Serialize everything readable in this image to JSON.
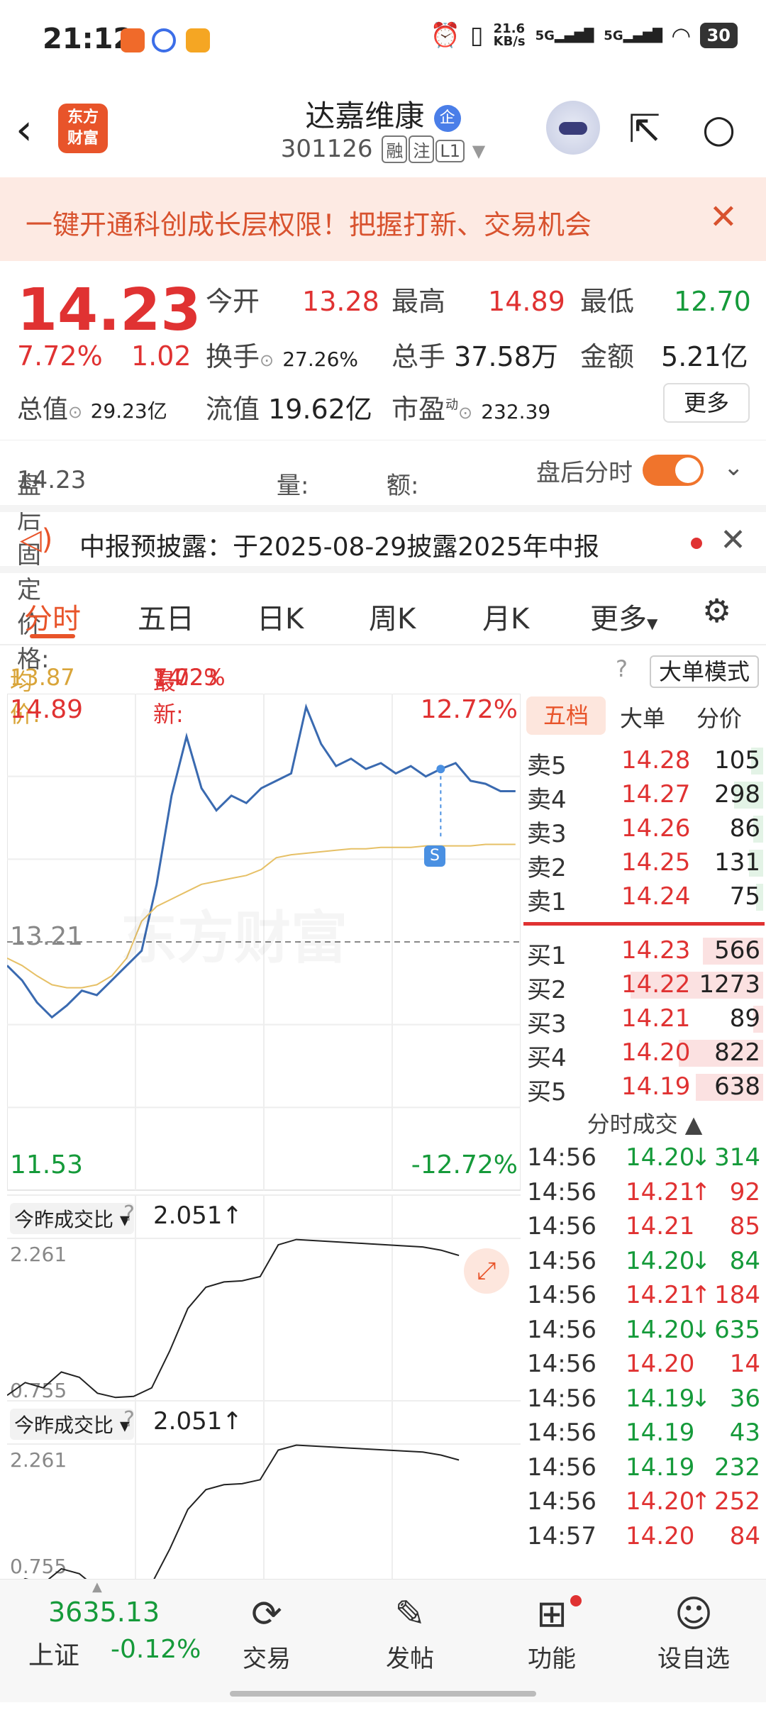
{
  "status_bar": {
    "time": "21:12",
    "net_speed": "21.6\nKB/s",
    "sig1": "5G",
    "sig2": "5G",
    "battery": "30"
  },
  "header": {
    "logo_text": "东方\n财富",
    "stock_name": "达嘉维康",
    "badge": "企",
    "code": "301126",
    "tags": [
      "融",
      "注",
      "L1"
    ]
  },
  "banner": {
    "text": "一键开通科创成长层权限！把握打新、交易机会"
  },
  "quote": {
    "price": "14.23",
    "change_pct": "7.72%",
    "change": "1.02",
    "open_label": "今开",
    "open": "13.28",
    "high_label": "最高",
    "high": "14.89",
    "low_label": "最低",
    "low": "12.70",
    "turnover_label": "换手",
    "turnover": "27.26%",
    "volume_label": "总手",
    "volume": "37.58万",
    "amount_label": "金额",
    "amount": "5.21亿",
    "total_cap_label": "总值",
    "total_cap": "29.23亿",
    "float_cap_label": "流值",
    "float_cap": "19.62亿",
    "pe_label": "市盈",
    "pe_sup": "动",
    "pe": "232.39",
    "more_label": "更多"
  },
  "after_hours": {
    "price_label": "盘后固定价格:",
    "price": "14.23",
    "vol_label": "量:",
    "vol": "--",
    "amt_label": "额:",
    "amt": "--",
    "toggle_label": "盘后分时"
  },
  "notice": {
    "text": "中报预披露：于2025-08-29披露2025年中报"
  },
  "tabs": [
    "分时",
    "五日",
    "日K",
    "周K",
    "月K",
    "更多"
  ],
  "avg_row": {
    "avg_label": "均价:",
    "avg": "13.87",
    "latest_label": "最新:",
    "latest": "14.23",
    "chg": "1.02",
    "pct": "7.72%",
    "mode_btn": "大单模式"
  },
  "chart": {
    "top_price": "14.89",
    "top_pct": "12.72%",
    "mid_price": "13.21",
    "bottom_price": "11.53",
    "bottom_pct": "-12.72%",
    "watermark": "东方财富",
    "marker": "S",
    "sub1_label": "今昨成交比",
    "sub1_value": "2.051",
    "sub1_max": "2.261",
    "sub1_min": "0.755",
    "sub2_label": "今昨成交比",
    "sub2_value": "2.051",
    "sub2_max": "2.261",
    "sub2_min": "0.755"
  },
  "chart_data": {
    "type": "line",
    "series": [
      {
        "name": "最新",
        "color": "#3a6ab0",
        "values": [
          13.05,
          12.95,
          12.8,
          12.7,
          12.78,
          12.88,
          12.85,
          12.95,
          13.05,
          13.15,
          13.6,
          14.2,
          14.6,
          14.25,
          14.1,
          14.2,
          14.15,
          14.25,
          14.3,
          14.35,
          14.8,
          14.55,
          14.4,
          14.45,
          14.38,
          14.42,
          14.35,
          14.4,
          14.33,
          14.38,
          14.42,
          14.3,
          14.28,
          14.23,
          14.23
        ]
      },
      {
        "name": "均价",
        "color": "#e6c066",
        "values": [
          13.1,
          13.05,
          12.98,
          12.92,
          12.9,
          12.9,
          12.92,
          12.98,
          13.1,
          13.35,
          13.45,
          13.5,
          13.55,
          13.6,
          13.62,
          13.64,
          13.66,
          13.7,
          13.78,
          13.8,
          13.81,
          13.82,
          13.83,
          13.84,
          13.84,
          13.85,
          13.85,
          13.85,
          13.86,
          13.86,
          13.86,
          13.86,
          13.87,
          13.87,
          13.87
        ]
      }
    ],
    "ylim": [
      11.53,
      14.89
    ]
  },
  "order_book": {
    "tabs": [
      "五档",
      "大单",
      "分价"
    ],
    "asks": [
      {
        "label": "卖5",
        "price": "14.28",
        "qty": "105",
        "w": 0.05
      },
      {
        "label": "卖4",
        "price": "14.27",
        "qty": "298",
        "w": 0.12
      },
      {
        "label": "卖3",
        "price": "14.26",
        "qty": "86",
        "w": 0.04
      },
      {
        "label": "卖2",
        "price": "14.25",
        "qty": "131",
        "w": 0.06
      },
      {
        "label": "卖1",
        "price": "14.24",
        "qty": "75",
        "w": 0.03
      }
    ],
    "bids": [
      {
        "label": "买1",
        "price": "14.23",
        "qty": "566",
        "w": 0.25
      },
      {
        "label": "买2",
        "price": "14.22",
        "qty": "1273",
        "w": 0.55
      },
      {
        "label": "买3",
        "price": "14.21",
        "qty": "89",
        "w": 0.04
      },
      {
        "label": "买4",
        "price": "14.20",
        "qty": "822",
        "w": 0.35
      },
      {
        "label": "买5",
        "price": "14.19",
        "qty": "638",
        "w": 0.28
      }
    ],
    "trades_title": "分时成交",
    "trades": [
      {
        "time": "14:56",
        "price": "14.20",
        "dir": "↓",
        "vol": "314",
        "c": "green"
      },
      {
        "time": "14:56",
        "price": "14.21",
        "dir": "↑",
        "vol": "92",
        "c": "red"
      },
      {
        "time": "14:56",
        "price": "14.21",
        "dir": "",
        "vol": "85",
        "c": "red"
      },
      {
        "time": "14:56",
        "price": "14.20",
        "dir": "↓",
        "vol": "84",
        "c": "green"
      },
      {
        "time": "14:56",
        "price": "14.21",
        "dir": "↑",
        "vol": "184",
        "c": "red"
      },
      {
        "time": "14:56",
        "price": "14.20",
        "dir": "↓",
        "vol": "635",
        "c": "green"
      },
      {
        "time": "14:56",
        "price": "14.20",
        "dir": "",
        "vol": "14",
        "c": "red"
      },
      {
        "time": "14:56",
        "price": "14.19",
        "dir": "↓",
        "vol": "36",
        "c": "green"
      },
      {
        "time": "14:56",
        "price": "14.19",
        "dir": "",
        "vol": "43",
        "c": "green"
      },
      {
        "time": "14:56",
        "price": "14.19",
        "dir": "",
        "vol": "232",
        "c": "green"
      },
      {
        "time": "14:56",
        "price": "14.20",
        "dir": "↑",
        "vol": "252",
        "c": "red"
      },
      {
        "time": "14:57",
        "price": "14.20",
        "dir": "",
        "vol": "84",
        "c": "red"
      }
    ]
  },
  "bottom_nav": {
    "index_value": "3635.13",
    "index_name": "上证",
    "index_pct": "-0.12%",
    "items": [
      "交易",
      "发帖",
      "功能",
      "设自选"
    ]
  }
}
